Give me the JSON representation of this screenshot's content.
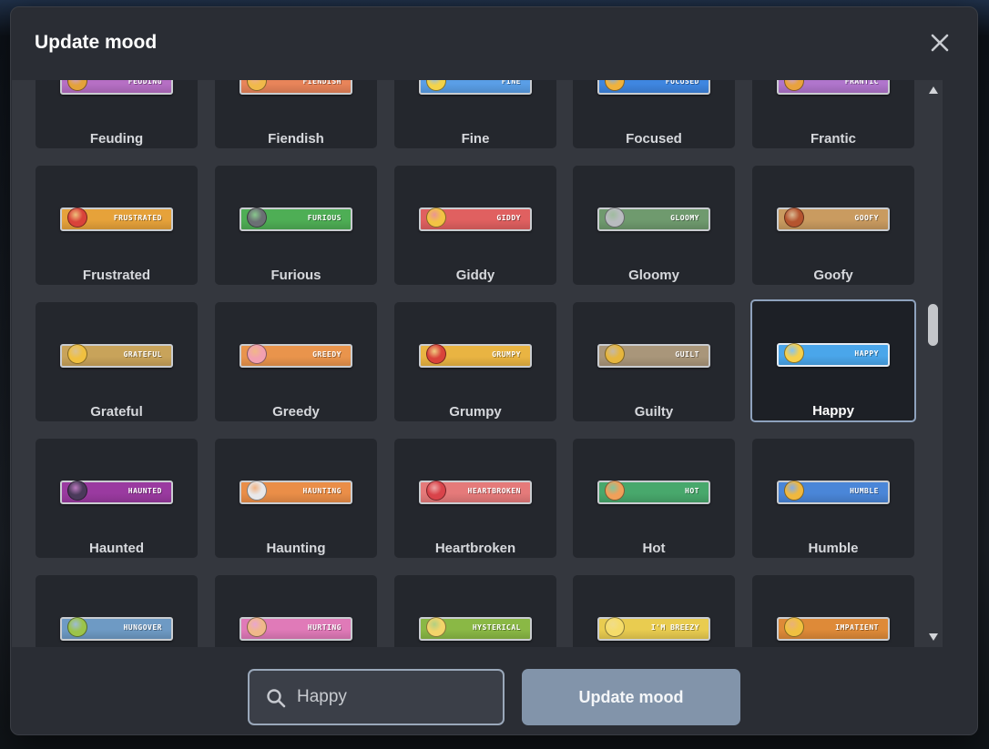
{
  "dialog": {
    "title": "Update mood",
    "close_label": "close"
  },
  "moods": [
    {
      "label": "Feuding",
      "badge": "FEUDING",
      "color": "#b66fc4",
      "face": "#e4a23a"
    },
    {
      "label": "Fiendish",
      "badge": "FIENDISH",
      "color": "#e8845a",
      "face": "#f0b94a"
    },
    {
      "label": "Fine",
      "badge": "FINE",
      "color": "#5a9ee6",
      "face": "#f3d34a"
    },
    {
      "label": "Focused",
      "badge": "FOCUSED",
      "color": "#3f86e0",
      "face": "#f0b23c"
    },
    {
      "label": "Frantic",
      "badge": "FRANTIC",
      "color": "#b075cc",
      "face": "#e9a23d"
    },
    {
      "label": "Frustrated",
      "badge": "FRUSTRATED",
      "color": "#e6a23a",
      "face": "#d9433a"
    },
    {
      "label": "Furious",
      "badge": "FURIOUS",
      "color": "#4eae55",
      "face": "#6b6f74"
    },
    {
      "label": "Giddy",
      "badge": "GIDDY",
      "color": "#e06060",
      "face": "#f3c244"
    },
    {
      "label": "Gloomy",
      "badge": "GLOOMY",
      "color": "#6f9a6e",
      "face": "#b9bcc0"
    },
    {
      "label": "Goofy",
      "badge": "GOOFY",
      "color": "#c99b60",
      "face": "#b5542f"
    },
    {
      "label": "Grateful",
      "badge": "GRATEFUL",
      "color": "#c8a35a",
      "face": "#f0c040"
    },
    {
      "label": "Greedy",
      "badge": "GREEDY",
      "color": "#e9944c",
      "face": "#f2a0b0"
    },
    {
      "label": "Grumpy",
      "badge": "GRUMPY",
      "color": "#e9b442",
      "face": "#d9433a"
    },
    {
      "label": "Guilty",
      "badge": "GUILT",
      "color": "#a9967a",
      "face": "#e6b63e"
    },
    {
      "label": "Happy",
      "badge": "HAPPY",
      "color": "#4aa6ea",
      "face": "#f6d04c"
    },
    {
      "label": "Haunted",
      "badge": "HAUNTED",
      "color": "#9a3aa0",
      "face": "#4a3a5a"
    },
    {
      "label": "Haunting",
      "badge": "HAUNTING",
      "color": "#ea8e48",
      "face": "#e8e8ea"
    },
    {
      "label": "Heartbroken",
      "badge": "HEARTBROKEN",
      "color": "#e57a7a",
      "face": "#d9434a"
    },
    {
      "label": "Hot",
      "badge": "HOT",
      "color": "#48a86c",
      "face": "#f0a05a"
    },
    {
      "label": "Humble",
      "badge": "HUMBLE",
      "color": "#4a86d8",
      "face": "#f0b83e"
    },
    {
      "label": "Hungover",
      "badge": "HUNGOVER",
      "color": "#6e9ac4",
      "face": "#9cc44a"
    },
    {
      "label": "Hurting",
      "badge": "HURTING",
      "color": "#e07ab8",
      "face": "#f0b88a"
    },
    {
      "label": "Hysterical",
      "badge": "HYSTERICAL",
      "color": "#8ab845",
      "face": "#f3d46a"
    },
    {
      "label": "Breezy",
      "badge": "I'M BREEZY",
      "color": "#e9cc50",
      "face": "#f5dc6a"
    },
    {
      "label": "Impatient",
      "badge": "IMPATIENT",
      "color": "#de8a38",
      "face": "#f0c040"
    }
  ],
  "selected_mood": "Happy",
  "search": {
    "value": "Happy",
    "icon": "search-icon"
  },
  "footer": {
    "update_button_label": "Update mood"
  },
  "colors": {
    "modal_bg": "#2a2d34",
    "tile_bg": "#24272d",
    "selected_border": "#8ea2bd",
    "button_bg": "#8294aa"
  }
}
